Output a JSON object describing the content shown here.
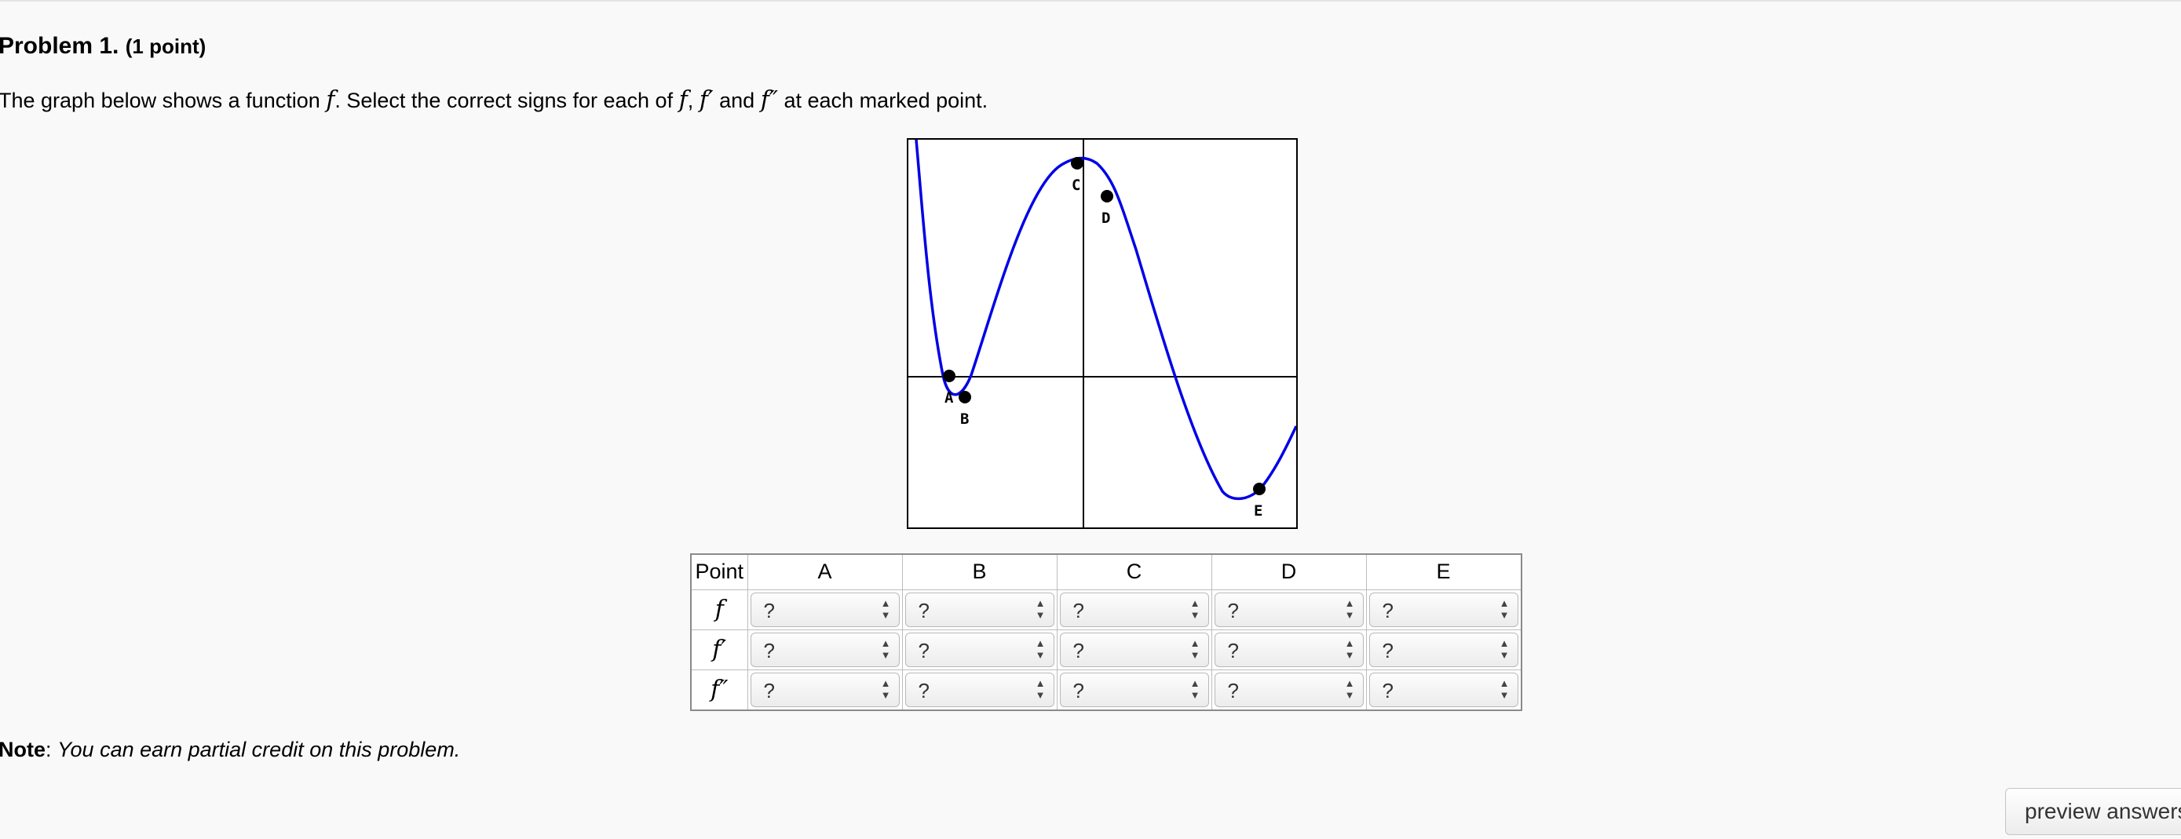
{
  "problem": {
    "title": "Problem 1.",
    "points": "(1 point)",
    "text_pre": "The graph below shows a function ",
    "text_mid1": ". Select the correct signs for each of ",
    "text_and": " and ",
    "text_post": " at each marked point.",
    "f": "f",
    "f_prime": "f′",
    "f_double_prime": "f″",
    "comma": ", "
  },
  "graph": {
    "points": [
      {
        "label": "A"
      },
      {
        "label": "B"
      },
      {
        "label": "C"
      },
      {
        "label": "D"
      },
      {
        "label": "E"
      }
    ],
    "curve_color": "#0000e6"
  },
  "table": {
    "corner_header": "Point",
    "columns": [
      "A",
      "B",
      "C",
      "D",
      "E"
    ],
    "rows": [
      {
        "label": "f",
        "values": [
          "?",
          "?",
          "?",
          "?",
          "?"
        ]
      },
      {
        "label": "f′",
        "values": [
          "?",
          "?",
          "?",
          "?",
          "?"
        ]
      },
      {
        "label": "f″",
        "values": [
          "?",
          "?",
          "?",
          "?",
          "?"
        ]
      }
    ]
  },
  "note": {
    "label": "Note",
    "colon": ": ",
    "text": "You can earn partial credit on this problem."
  },
  "buttons": {
    "preview": "preview answers"
  }
}
